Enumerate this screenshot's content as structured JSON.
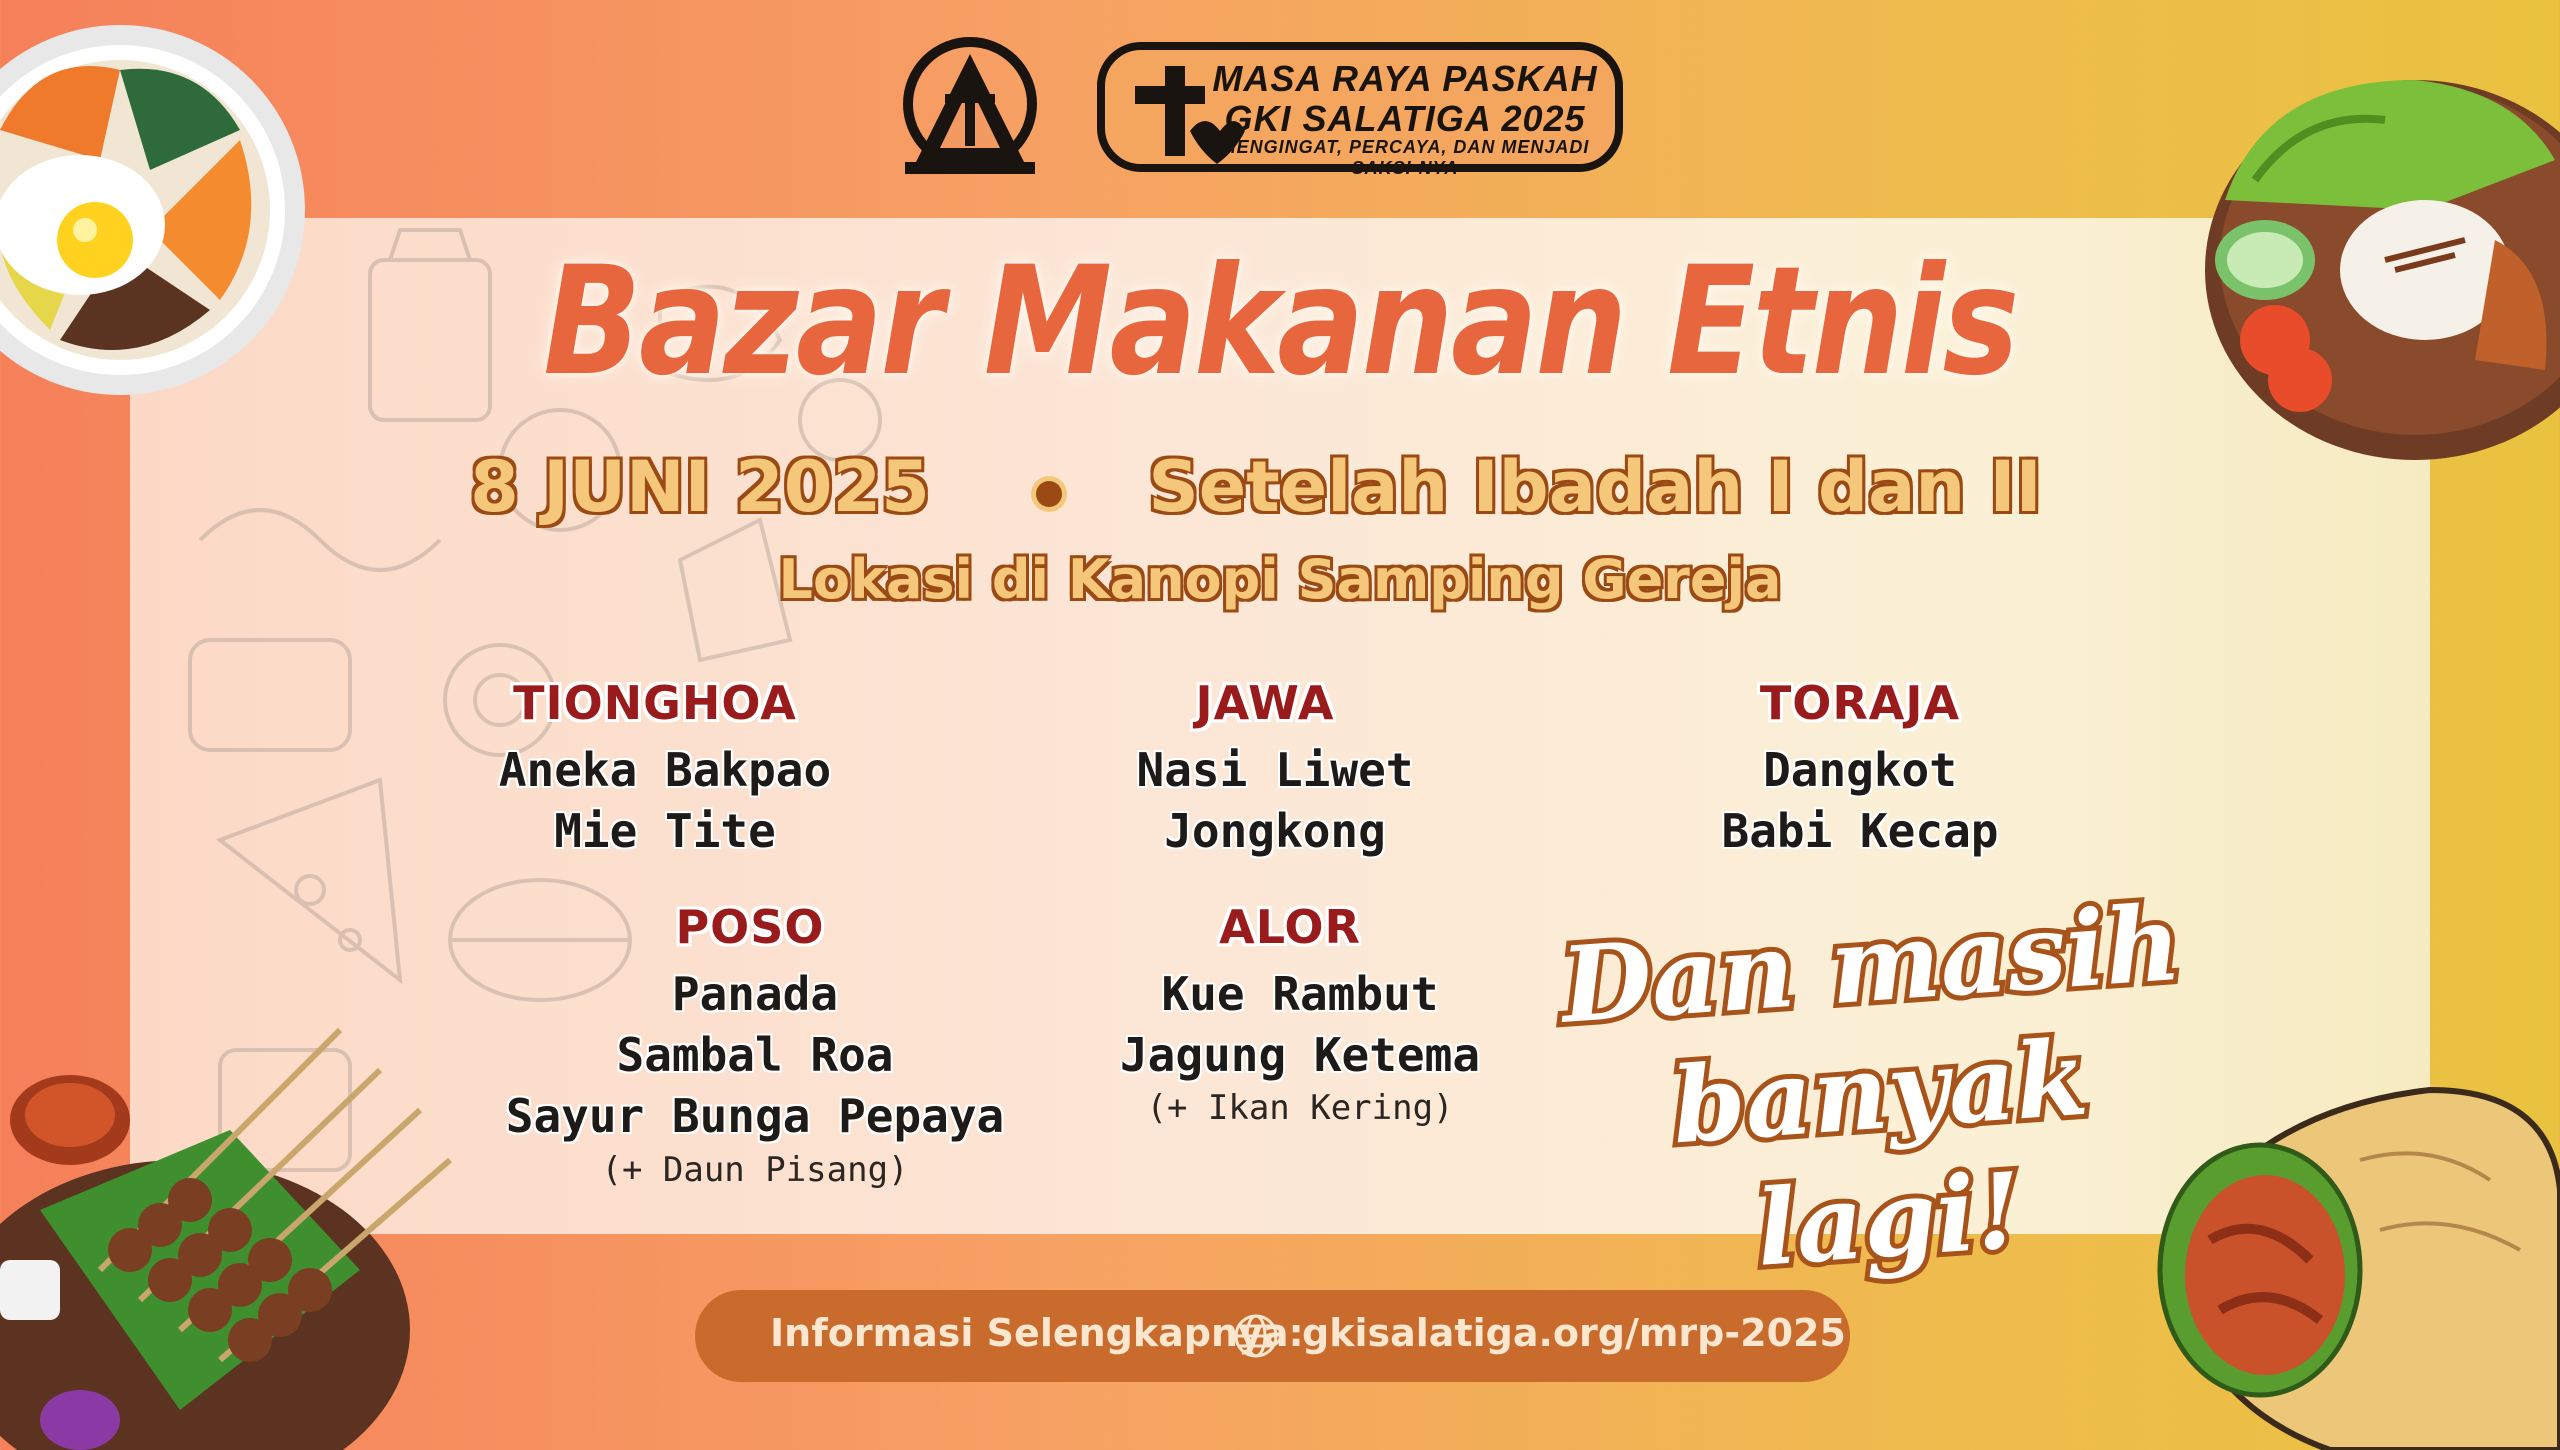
{
  "logo": {
    "badge_line1": "MASA RAYA PASKAH",
    "badge_line2": "GKI SALATIGA 2025",
    "badge_tagline": "MENGINGAT, PERCAYA, DAN MENJADI SAKSI-NYA"
  },
  "title": "Bazar Makanan Etnis",
  "event": {
    "date": "8 JUNI 2025",
    "time": "Setelah Ibadah I dan II",
    "location": "Lokasi di Kanopi Samping Gereja"
  },
  "menu": [
    {
      "category": "TIONGHOA",
      "items": [
        "Aneka Bakpao",
        "Mie Tite"
      ],
      "note": ""
    },
    {
      "category": "JAWA",
      "items": [
        "Nasi Liwet",
        "Jongkong"
      ],
      "note": ""
    },
    {
      "category": "TORAJA",
      "items": [
        "Dangkot",
        "Babi Kecap"
      ],
      "note": ""
    },
    {
      "category": "POSO",
      "items": [
        "Panada",
        "Sambal Roa",
        "Sayur Bunga Pepaya"
      ],
      "note": "(+ Daun Pisang)"
    },
    {
      "category": "ALOR",
      "items": [
        "Kue Rambut",
        "Jagung Ketema"
      ],
      "note": "(+ Ikan Kering)"
    }
  ],
  "more": {
    "line1": "Dan masih",
    "line2": "banyak lagi!"
  },
  "footer": {
    "label": "Informasi Selengkapnya:",
    "url": "gkisalatiga.org/mrp-2025",
    "icon": "globe-icon"
  },
  "colors": {
    "title": "#e8663e",
    "category": "#9a1b1b",
    "accent_brown": "#9b4a13",
    "footer_bg": "#c86b2c"
  }
}
